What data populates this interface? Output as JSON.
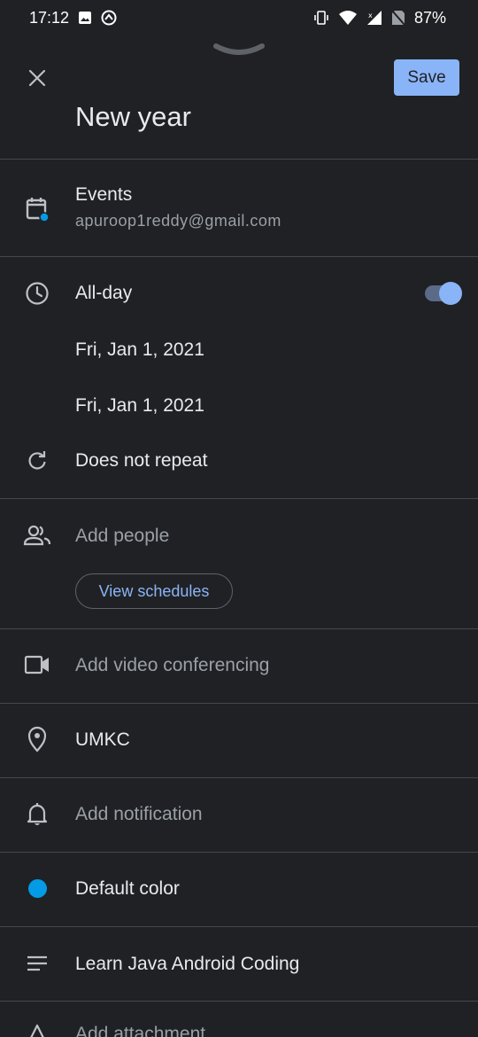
{
  "status_bar": {
    "time": "17:12",
    "battery": "87%",
    "icons": [
      "image-icon",
      "sync-icon",
      "vibrate-icon",
      "wifi-icon",
      "signal-icon",
      "no-sim-icon"
    ]
  },
  "header": {
    "title": "New year",
    "save_label": "Save",
    "accent_color": "#8ab4f8"
  },
  "calendar": {
    "name": "Events",
    "account": "apuroop1reddy@gmail.com"
  },
  "time": {
    "all_day_label": "All-day",
    "all_day_enabled": true,
    "start_date": "Fri, Jan 1, 2021",
    "end_date": "Fri, Jan 1, 2021",
    "repeat_label": "Does not repeat"
  },
  "people": {
    "add_label": "Add people",
    "view_schedules_label": "View schedules"
  },
  "conferencing": {
    "label": "Add video conferencing"
  },
  "location": {
    "value": "UMKC"
  },
  "notification": {
    "label": "Add notification"
  },
  "color": {
    "label": "Default color",
    "value": "#039be5"
  },
  "description": {
    "value": "Learn Java Android Coding"
  },
  "attachment": {
    "label": "Add attachment"
  }
}
